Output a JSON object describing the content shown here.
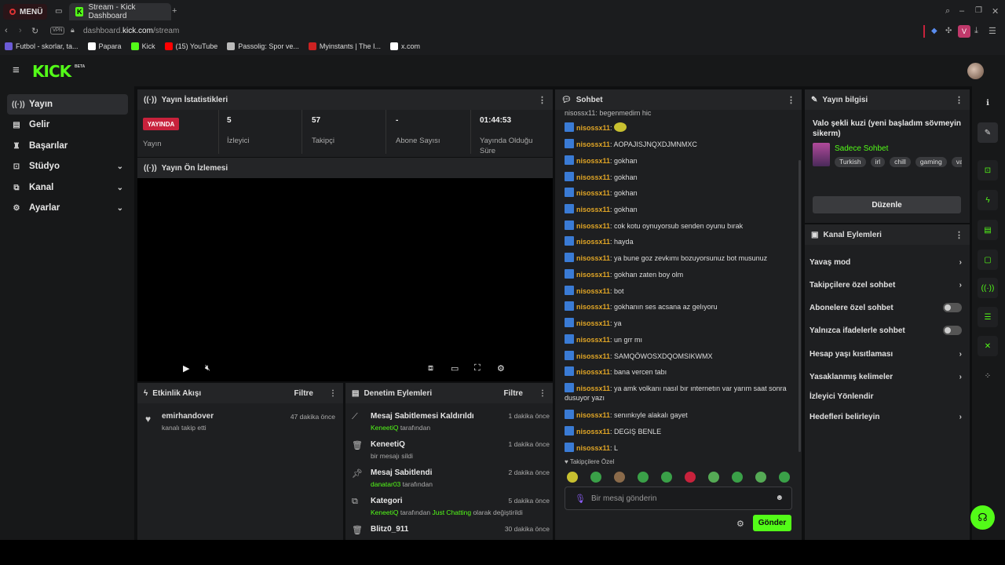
{
  "browser": {
    "menu_label": "MENÜ",
    "tab_title": "Stream - Kick Dashboard",
    "url_host": "dashboard.",
    "url_domain": "kick.com",
    "url_path": "/stream",
    "vpn_label": "VPN",
    "profile_letter": "V",
    "bookmarks": [
      {
        "label": "Futbol - skorlar, ta...",
        "color": "#6b5bd6"
      },
      {
        "label": "Papara",
        "color": "#ffffff"
      },
      {
        "label": "Kick",
        "color": "#53fc18"
      },
      {
        "label": "(15) YouTube",
        "color": "#ff0000"
      },
      {
        "label": "Passolig: Spor ve...",
        "color": "#bbbbbb"
      },
      {
        "label": "Myinstants | The I...",
        "color": "#cc2222"
      },
      {
        "label": "x.com",
        "color": "#ffffff"
      }
    ]
  },
  "logo": {
    "text": "KICK",
    "beta": "BETA"
  },
  "sidebar": {
    "items": [
      {
        "label": "Yayın",
        "icon": "broadcast-icon"
      },
      {
        "label": "Gelir",
        "icon": "revenue-icon"
      },
      {
        "label": "Başarılar",
        "icon": "trophy-icon"
      },
      {
        "label": "Stüdyo",
        "icon": "studio-icon"
      },
      {
        "label": "Kanal",
        "icon": "channel-icon"
      },
      {
        "label": "Ayarlar",
        "icon": "gear-icon"
      }
    ]
  },
  "stats": {
    "title": "Yayın İstatistikleri",
    "live_badge": "YAYINDA",
    "live_label": "Yayın",
    "viewers": {
      "value": "5",
      "label": "İzleyici"
    },
    "followers": {
      "value": "57",
      "label": "Takipçi"
    },
    "subs": {
      "value": "-",
      "label": "Abone Sayısı"
    },
    "uptime": {
      "value": "01:44:53",
      "label": "Yayında Olduğu Süre"
    }
  },
  "preview": {
    "title": "Yayın Ön İzlemesi"
  },
  "activity": {
    "title": "Etkinlik Akışı",
    "filter": "Filtre",
    "items": [
      {
        "user": "emirhandover",
        "action": "kanalı takip etti",
        "time": "47 dakika önce"
      }
    ]
  },
  "mod_actions": {
    "title": "Denetim Eylemleri",
    "filter": "Filtre",
    "items": [
      {
        "title": "Mesaj Sabitlemesi Kaldırıldı",
        "actor": "KeneetiQ",
        "rest": " tarafından",
        "time": "1 dakika önce"
      },
      {
        "title": "KeneetiQ",
        "actor": "",
        "rest": "bir mesajı sildi",
        "time": "1 dakika önce"
      },
      {
        "title": "Mesaj Sabitlendi",
        "actor": "danatar03",
        "rest": " tarafından",
        "time": "2 dakika önce"
      },
      {
        "title": "Kategori",
        "actor": "KeneetiQ",
        "rest": " tarafından ",
        "extra": "Just Chatting",
        "extra_rest": " olarak değiştirildi",
        "time": "5 dakika önce"
      },
      {
        "title": "Blitz0_911",
        "actor": "",
        "rest": "",
        "time": "30 dakika önce"
      }
    ]
  },
  "chat": {
    "title": "Sohbet",
    "messages": [
      {
        "user": "",
        "text": "nisossx11: begenmedim hic"
      },
      {
        "user": "nisossx11",
        "text": ""
      },
      {
        "user": "nisossx11",
        "text": "AOPAJISJNQXDJMNMXC"
      },
      {
        "user": "nisossx11",
        "text": "gokhan"
      },
      {
        "user": "nisossx11",
        "text": "gokhan"
      },
      {
        "user": "nisossx11",
        "text": "gokhan"
      },
      {
        "user": "nisossx11",
        "text": "gokhan"
      },
      {
        "user": "nisossx11",
        "text": "cok kotu oynuyorsub senden oyunu bırak"
      },
      {
        "user": "nisossx11",
        "text": "hayda"
      },
      {
        "user": "nisossx11",
        "text": "ya bune goz zevkımı bozuyorsunuz bot musunuz"
      },
      {
        "user": "nisossx11",
        "text": "gokhan zaten boy olm"
      },
      {
        "user": "nisossx11",
        "text": "bot"
      },
      {
        "user": "nisossx11",
        "text": "gokhanın ses acsana az gelıyoru"
      },
      {
        "user": "nisossx11",
        "text": "ya"
      },
      {
        "user": "nisossx11",
        "text": "un grr mı"
      },
      {
        "user": "nisossx11",
        "text": "SAMQÖWOSXDQOMSIKWMX"
      },
      {
        "user": "nisossx11",
        "text": "bana vercen tabı"
      },
      {
        "user": "nisossx11",
        "text": "ya amk volkanı nasıl bır ınternetın var yarım saat sonra dusuyor yazı"
      },
      {
        "user": "nisossx11",
        "text": "senınkıyle alakalı gayet"
      },
      {
        "user": "nisossx11",
        "text": "DEGIŞ BENLE"
      },
      {
        "user": "nisossx11",
        "text": "L"
      }
    ],
    "followers_only": "Takipçilere Özel",
    "input_placeholder": "Bir mesaj gönderin",
    "send": "Gönder"
  },
  "stream_info": {
    "title": "Yayın bilgisi",
    "stream_title": "Valo şekli kuzi (yeni başladım sövmeyin sikerm)",
    "category": "Sadece Sohbet",
    "tags": [
      "Turkish",
      "irl",
      "chill",
      "gaming",
      "val"
    ],
    "edit": "Düzenle"
  },
  "channel_actions": {
    "title": "Kanal Eylemleri",
    "items": [
      {
        "label": "Yavaş mod",
        "control": "chevron"
      },
      {
        "label": "Takipçilere özel sohbet",
        "control": "chevron"
      },
      {
        "label": "Abonelere özel sohbet",
        "control": "toggle"
      },
      {
        "label": "Yalnızca ifadelerle sohbet",
        "control": "toggle"
      },
      {
        "label": "Hesap yaşı kısıtlaması",
        "control": "chevron"
      },
      {
        "label": "Yasaklanmış kelimeler",
        "control": "chevron"
      },
      {
        "label": "İzleyici Yönlendir",
        "control": "none"
      },
      {
        "label": "Hedefleri belirleyin",
        "control": "chevron"
      }
    ]
  },
  "colors": {
    "brand": "#53fc18",
    "live": "#c8223c",
    "username": "#e0a526"
  }
}
